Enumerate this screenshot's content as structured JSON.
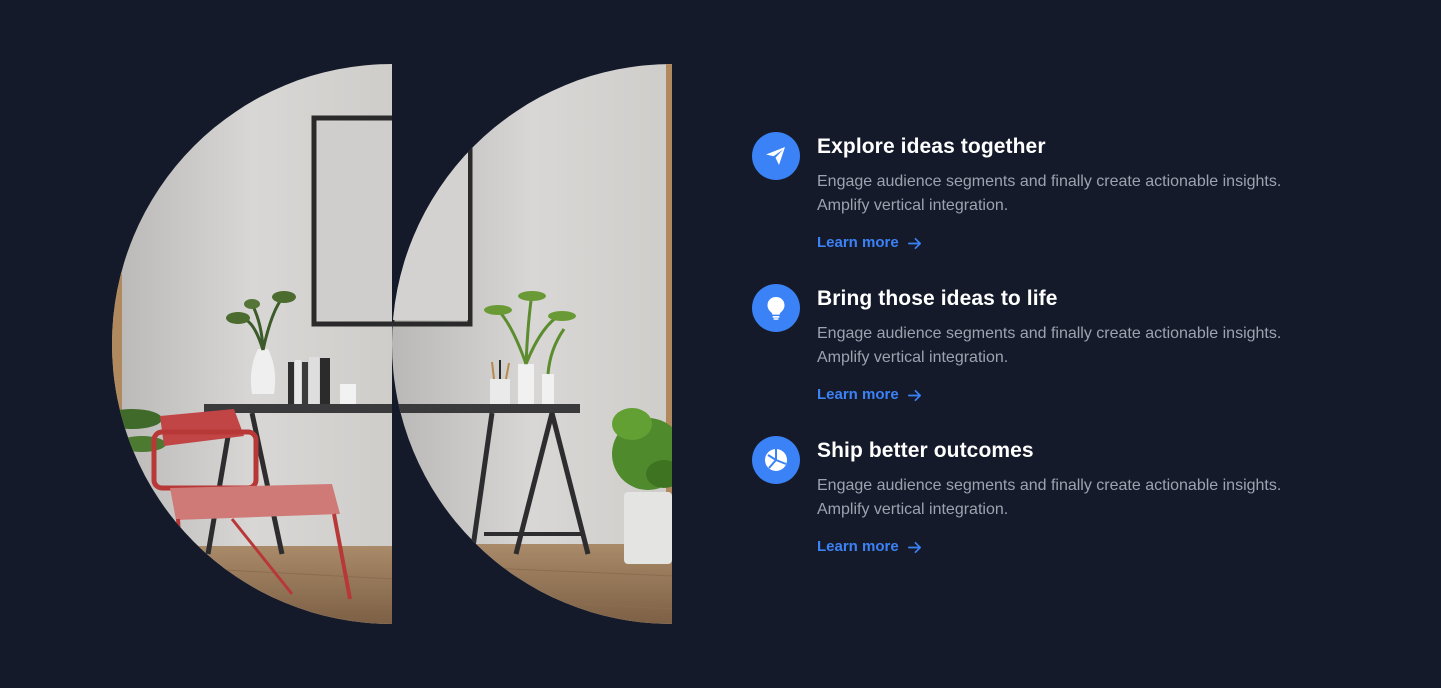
{
  "features": [
    {
      "icon": "paper-plane-icon",
      "title": "Explore ideas together",
      "description": "Engage audience segments and finally create actionable insights. Amplify vertical integration.",
      "link": "Learn more"
    },
    {
      "icon": "lightbulb-icon",
      "title": "Bring those ideas to life",
      "description": "Engage audience segments and finally create actionable insights. Amplify vertical integration.",
      "link": "Learn more"
    },
    {
      "icon": "pie-chart-icon",
      "title": "Ship better outcomes",
      "description": "Engage audience segments and finally create actionable insights. Amplify vertical integration.",
      "link": "Learn more"
    }
  ],
  "colors": {
    "background": "#151a2a",
    "accent": "#3b82f6",
    "title": "#ffffff",
    "body_text": "#9ca3af"
  }
}
